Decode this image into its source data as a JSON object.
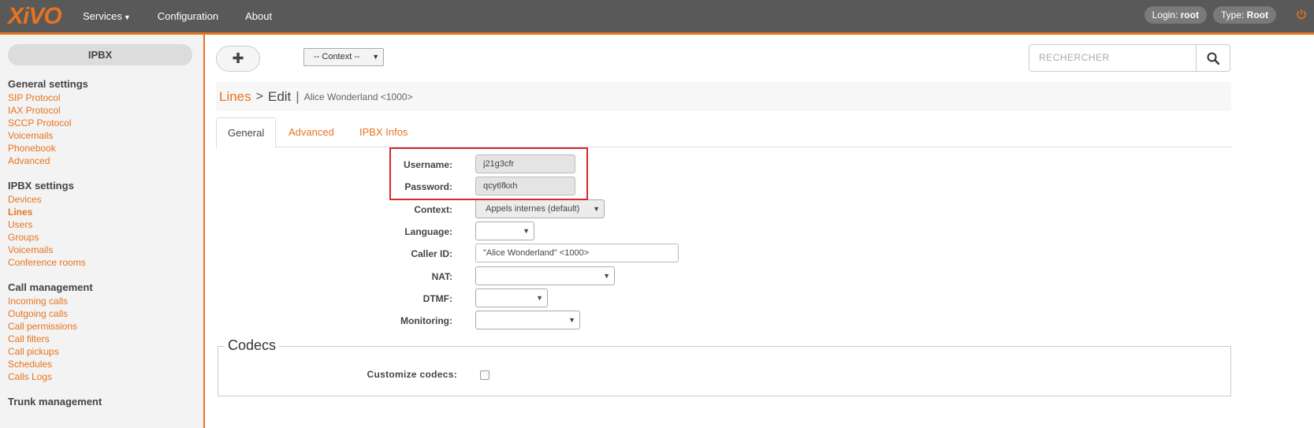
{
  "app": {
    "logo": "XiVO"
  },
  "nav": {
    "services": "Services",
    "configuration": "Configuration",
    "about": "About"
  },
  "user": {
    "login_label": "Login:",
    "login_value": "root",
    "type_label": "Type:",
    "type_value": "Root"
  },
  "sidebar": {
    "title": "IPBX",
    "sections": [
      {
        "heading": "General settings",
        "items": [
          "SIP Protocol",
          "IAX Protocol",
          "SCCP Protocol",
          "Voicemails",
          "Phonebook",
          "Advanced"
        ]
      },
      {
        "heading": "IPBX settings",
        "items": [
          "Devices",
          "Lines",
          "Users",
          "Groups",
          "Voicemails",
          "Conference rooms"
        ]
      },
      {
        "heading": "Call management",
        "items": [
          "Incoming calls",
          "Outgoing calls",
          "Call permissions",
          "Call filters",
          "Call pickups",
          "Schedules",
          "Calls Logs"
        ]
      },
      {
        "heading": "Trunk management",
        "items": []
      }
    ]
  },
  "toolbar": {
    "add_label": "✚",
    "context_select": "-- Context --",
    "search_placeholder": "RECHERCHER"
  },
  "breadcrumb": {
    "link": "Lines",
    "sep": ">",
    "current": "Edit",
    "pipe": "|",
    "name": "Alice Wonderland <1000>"
  },
  "tabs": [
    "General",
    "Advanced",
    "IPBX Infos"
  ],
  "form": {
    "username": {
      "label": "Username:",
      "value": "j21g3cfr"
    },
    "password": {
      "label": "Password:",
      "value": "qcy6fkxh"
    },
    "context": {
      "label": "Context:",
      "value": "Appels internes (default)"
    },
    "language": {
      "label": "Language:",
      "value": ""
    },
    "callerid": {
      "label": "Caller ID:",
      "value": "\"Alice Wonderland\" <1000>"
    },
    "nat": {
      "label": "NAT:",
      "value": ""
    },
    "dtmf": {
      "label": "DTMF:",
      "value": ""
    },
    "monitoring": {
      "label": "Monitoring:",
      "value": ""
    }
  },
  "codecs": {
    "legend": "Codecs",
    "customize_label": "Customize codecs:"
  },
  "colors": {
    "accent": "#e8731f",
    "topbar": "#595959",
    "highlight": "#d7282f"
  }
}
